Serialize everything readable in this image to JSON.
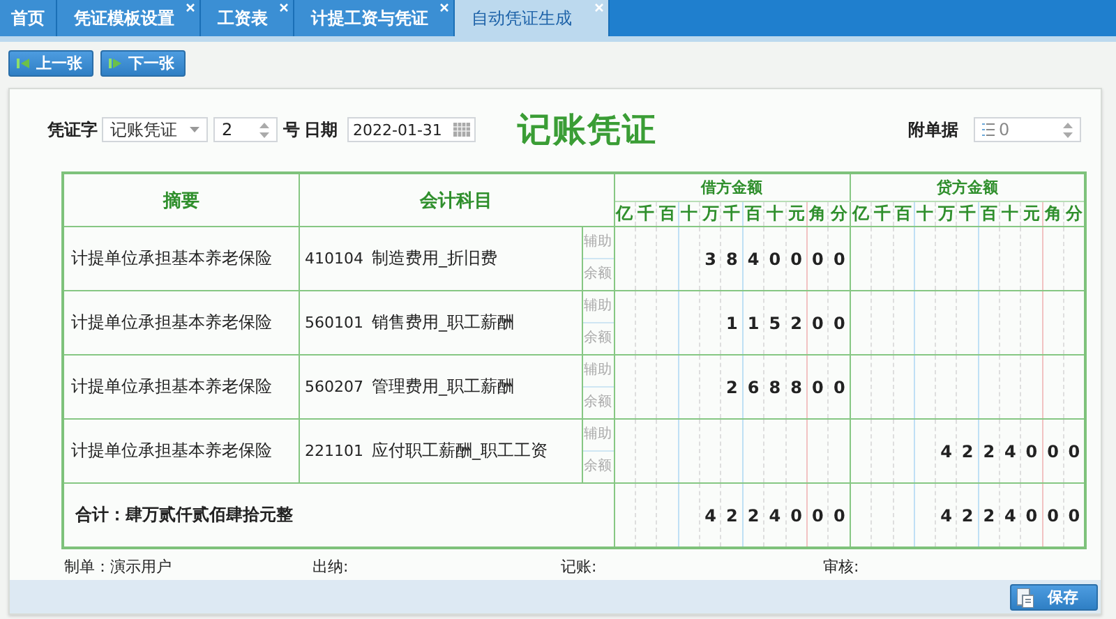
{
  "tabs": [
    {
      "label": "首页",
      "selected": false,
      "closable": false
    },
    {
      "label": "凭证模板设置",
      "selected": false,
      "closable": true
    },
    {
      "label": "工资表",
      "selected": false,
      "closable": true
    },
    {
      "label": "计提工资与凭证",
      "selected": false,
      "closable": true
    },
    {
      "label": "自动凭证生成",
      "selected": true,
      "closable": true
    }
  ],
  "toolbar": {
    "buttons": [
      "上一张",
      "下一张"
    ]
  },
  "voucher": {
    "word_label": "凭证字",
    "word_value": "记账凭证",
    "number": "2",
    "number_label": "号",
    "date_label": "日期",
    "date": "2022-01-31",
    "title": "记账凭证",
    "attachments_label": "附单据",
    "attachments": "0",
    "columns": {
      "summary": "摘要",
      "account": "会计科目",
      "debit": "借方金额",
      "credit": "贷方金额",
      "debit_units": [
        "亿",
        "千",
        "百",
        "十",
        "万",
        "千",
        "百",
        "十",
        "元",
        "角",
        "分"
      ],
      "credit_units": [
        "亿",
        "千",
        "百",
        "十",
        "万",
        "千",
        "百",
        "十",
        "元",
        "角",
        "分"
      ]
    },
    "rows": [
      {
        "summary": "计提单位承担基本养老保险",
        "account_code": "410104",
        "account_name": "制造费用_折旧费",
        "aux_label": "辅助",
        "balance_label": "余额",
        "debit": [
          "3",
          "8",
          "4",
          "0",
          "0",
          "0",
          "0"
        ]
      },
      {
        "summary": "计提单位承担基本养老保险",
        "account_code": "560101",
        "account_name": "销售费用_职工薪酬",
        "aux_label": "辅助",
        "balance_label": "余额",
        "debit": [
          "1",
          "1",
          "5",
          "2",
          "0",
          "0"
        ]
      },
      {
        "summary": "计提单位承担基本养老保险",
        "account_code": "560207",
        "account_name": "管理费用_职工薪酬",
        "aux_label": "辅助",
        "balance_label": "余额",
        "debit": [
          "2",
          "6",
          "8",
          "8",
          "0",
          "0"
        ]
      },
      {
        "summary": "计提单位承担基本养老保险",
        "account_code": "221101",
        "account_name": "应付职工薪酬_职工工资",
        "aux_label": "辅助",
        "balance_label": "余额",
        "credit": [
          "4",
          "2",
          "2",
          "4",
          "0",
          "0",
          "0"
        ]
      }
    ],
    "total": {
      "label": "合计：肆万贰仟贰佰肆拾元整",
      "debit": [
        "4",
        "2",
        "2",
        "4",
        "0",
        "0",
        "0"
      ],
      "credit": [
        "4",
        "2",
        "2",
        "4",
        "0",
        "0",
        "0"
      ]
    },
    "signatures": [
      "制单：演示用户",
      "出纳:",
      "记账:",
      "审核:"
    ]
  },
  "save_button": "保存"
}
